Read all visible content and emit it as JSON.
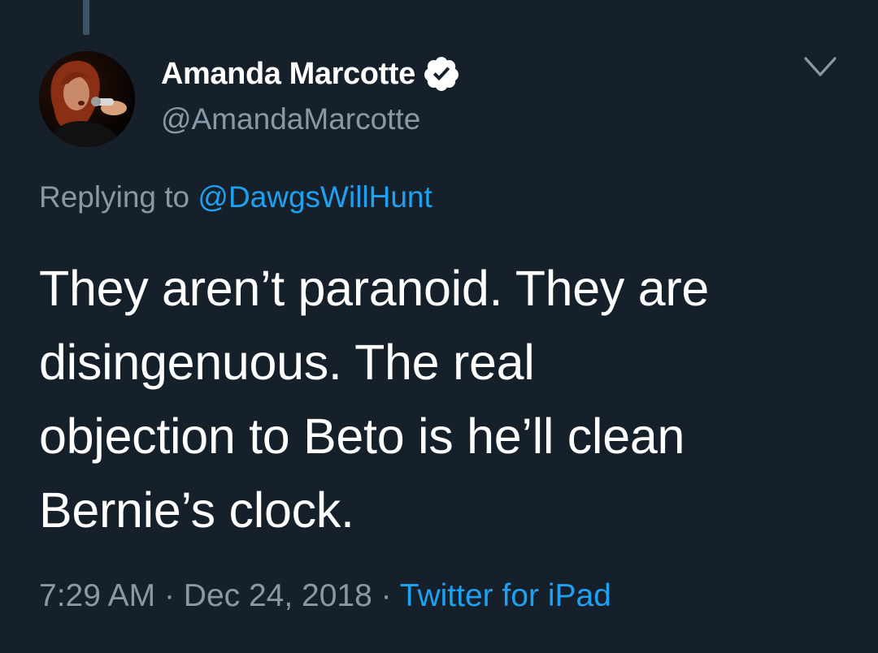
{
  "tweet": {
    "author": {
      "display_name": "Amanda Marcotte",
      "handle": "@AmandaMarcotte",
      "verified": true
    },
    "reply": {
      "prefix": "Replying to",
      "user": "@DawgsWillHunt"
    },
    "text_lines": [
      "They aren’t paranoid. They are",
      "disingenuous. The real",
      "objection to Beto is he’ll clean",
      "Bernie’s clock."
    ],
    "time": "7:29 AM",
    "separator": "·",
    "date": "Dec 24, 2018",
    "source": "Twitter for iPad"
  },
  "icons": {
    "verified": "verified-badge-icon",
    "menu": "chevron-down-icon"
  },
  "colors": {
    "background": "#15202b",
    "accent": "#1da1f2",
    "secondary_text": "#8899a6",
    "primary_text": "#ffffff"
  }
}
